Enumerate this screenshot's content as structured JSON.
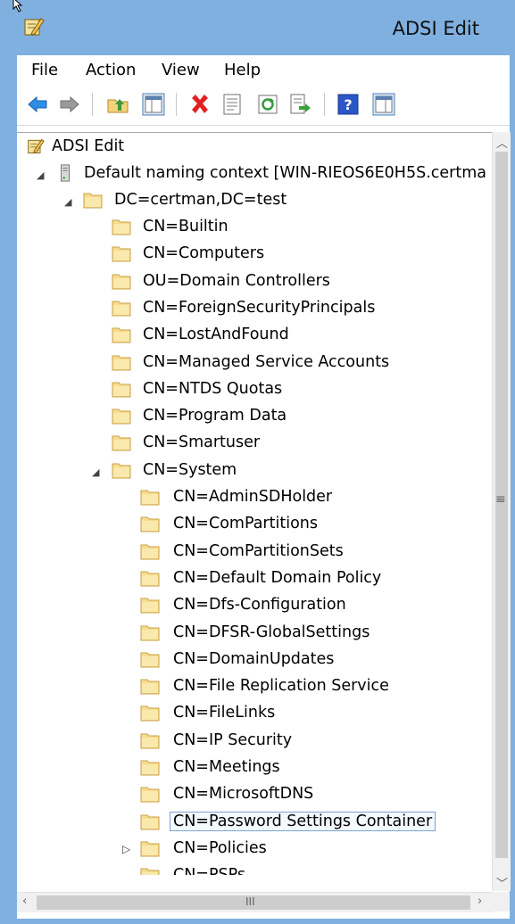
{
  "window": {
    "title": "ADSI Edit"
  },
  "menu": [
    "File",
    "Action",
    "View",
    "Help"
  ],
  "toolbar": {
    "buttons": [
      "back-icon",
      "forward-icon",
      "up-folder-icon",
      "show-hide-tree-icon",
      "delete-icon",
      "properties-icon",
      "refresh-icon",
      "export-list-icon",
      "help-icon",
      "action-pane-icon"
    ]
  },
  "tree": {
    "root": "ADSI Edit",
    "context": "Default naming context [WIN-RIEOS6E0H5S.certma",
    "domain": "DC=certman,DC=test",
    "domain_children": [
      "CN=Builtin",
      "CN=Computers",
      "OU=Domain Controllers",
      "CN=ForeignSecurityPrincipals",
      "CN=LostAndFound",
      "CN=Managed Service Accounts",
      "CN=NTDS Quotas",
      "CN=Program Data",
      "CN=Smartuser",
      "CN=System"
    ],
    "system_children": [
      "CN=AdminSDHolder",
      "CN=ComPartitions",
      "CN=ComPartitionSets",
      "CN=Default Domain Policy",
      "CN=Dfs-Configuration",
      "CN=DFSR-GlobalSettings",
      "CN=DomainUpdates",
      "CN=File Replication Service",
      "CN=FileLinks",
      "CN=IP Security",
      "CN=Meetings",
      "CN=MicrosoftDNS",
      "CN=Password Settings Container",
      "CN=Policies",
      "CN=PSPs"
    ],
    "selected": "CN=Password Settings Container"
  },
  "scrollbar": {
    "h_grip": "III",
    "v_grip": "≡"
  }
}
